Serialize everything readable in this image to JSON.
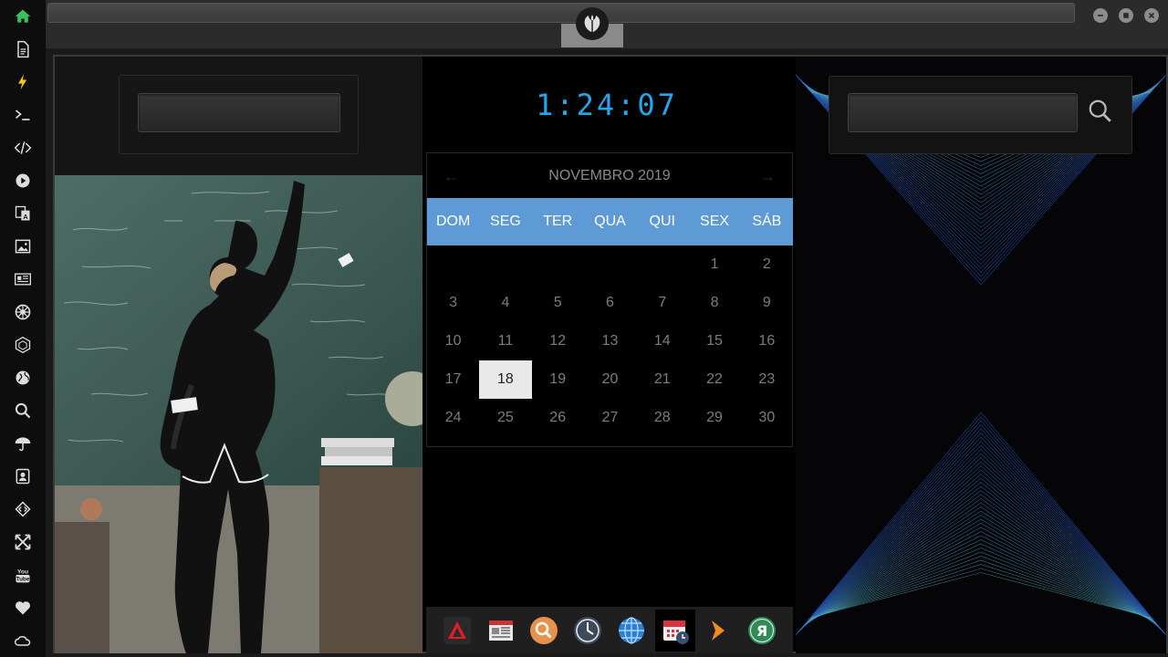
{
  "dock": {
    "items": [
      {
        "name": "home-icon",
        "color": "#3fbf5a"
      },
      {
        "name": "document-icon"
      },
      {
        "name": "lightning-icon",
        "color": "#f0c419"
      },
      {
        "name": "terminal-icon"
      },
      {
        "name": "code-icon"
      },
      {
        "name": "play-icon"
      },
      {
        "name": "translate-icon"
      },
      {
        "name": "image-icon"
      },
      {
        "name": "news-icon"
      },
      {
        "name": "galactic-empire-icon"
      },
      {
        "name": "hexagon-icon"
      },
      {
        "name": "globe-icon"
      },
      {
        "name": "search-icon"
      },
      {
        "name": "umbrella-icon"
      },
      {
        "name": "contacts-icon"
      },
      {
        "name": "code-diamond-icon"
      },
      {
        "name": "expand-icon"
      },
      {
        "name": "youtube-icon",
        "label": "You Tube"
      },
      {
        "name": "heart-icon"
      },
      {
        "name": "cloud-icon"
      }
    ]
  },
  "clock": {
    "time": "1:24:07",
    "color": "#25a6e8"
  },
  "calendar": {
    "month_label": "NOVEMBRO 2019",
    "prev_label": "←",
    "next_label": "→",
    "weekdays": [
      "DOM",
      "SEG",
      "TER",
      "QUA",
      "QUI",
      "SEX",
      "SÁB"
    ],
    "weeks": [
      [
        "",
        "",
        "",
        "",
        "",
        "1",
        "2"
      ],
      [
        "3",
        "4",
        "5",
        "6",
        "7",
        "8",
        "9"
      ],
      [
        "10",
        "11",
        "12",
        "13",
        "14",
        "15",
        "16"
      ],
      [
        "17",
        "18",
        "19",
        "20",
        "21",
        "22",
        "23"
      ],
      [
        "24",
        "25",
        "26",
        "27",
        "28",
        "29",
        "30"
      ]
    ],
    "today": "18",
    "header_color": "#5e9ad6"
  },
  "taskbar": {
    "items": [
      {
        "name": "red-triangle-app-icon"
      },
      {
        "name": "newspaper-app-icon"
      },
      {
        "name": "search-app-icon"
      },
      {
        "name": "clock-app-icon"
      },
      {
        "name": "globe-app-icon"
      },
      {
        "name": "calendar-app-icon",
        "active": true
      },
      {
        "name": "arrow-app-icon"
      },
      {
        "name": "yandex-app-icon",
        "label": "Я"
      }
    ]
  },
  "search_left": {
    "value": ""
  },
  "search_right": {
    "value": ""
  }
}
